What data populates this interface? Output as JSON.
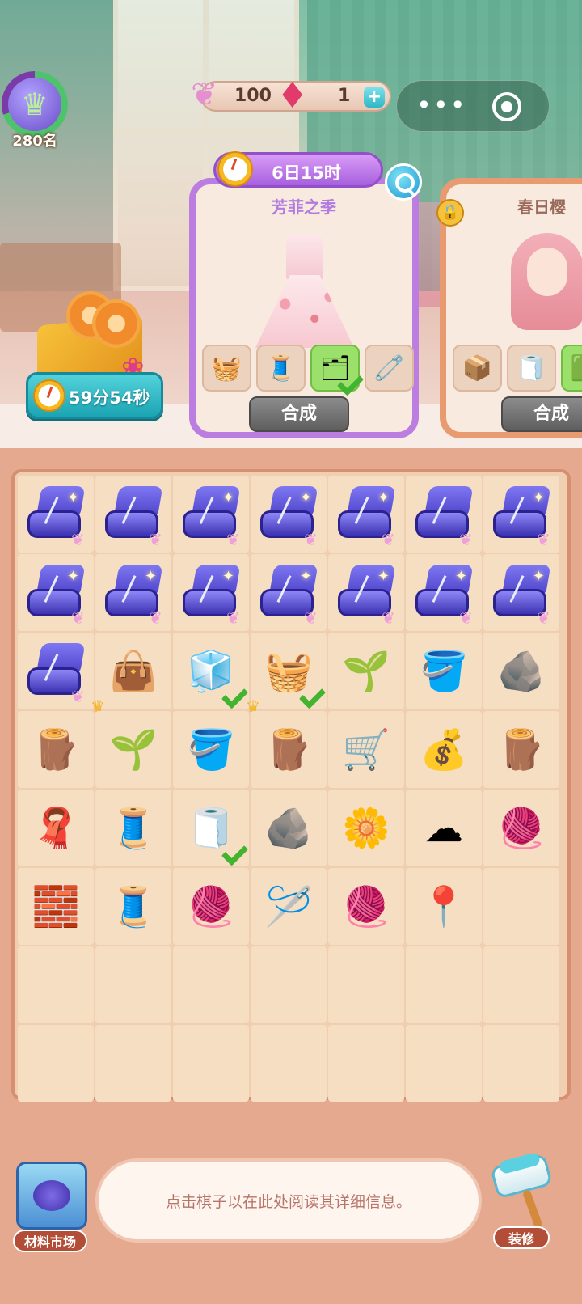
{
  "rank": {
    "label": "280名",
    "icon": "crown-icon"
  },
  "currency": {
    "feather_value": "100",
    "gem_value": "1",
    "plus_label": "+"
  },
  "capsule": {
    "more_label": "•••"
  },
  "event": {
    "timer": "59分54秒"
  },
  "cards": [
    {
      "timer": "6日15时",
      "title": "芳菲之季",
      "materials": [
        {
          "icon": "cotton-roll-basket-icon",
          "glyph": "🧺",
          "done": false
        },
        {
          "icon": "fabric-box-icon",
          "glyph": "🧵",
          "done": false
        },
        {
          "icon": "fabric-box-blue-icon",
          "glyph": "🗂",
          "done": true
        },
        {
          "icon": "pink-sewing-machine-icon",
          "glyph": "🧷",
          "done": false
        }
      ],
      "button": "合成"
    },
    {
      "title": "春日樱",
      "locked": true,
      "materials": [
        {
          "icon": "fabric-stack-box-icon",
          "glyph": "📦",
          "done": false
        },
        {
          "icon": "cotton-roll-icon",
          "glyph": "🧻",
          "done": false
        },
        {
          "icon": "green-item-icon",
          "glyph": "🟩",
          "done": true
        }
      ],
      "button": "合成"
    }
  ],
  "board": {
    "cells": [
      {
        "kind": "sewbox",
        "sparkle": true
      },
      {
        "kind": "sewbox",
        "sparkle": false
      },
      {
        "kind": "sewbox",
        "sparkle": true
      },
      {
        "kind": "sewbox",
        "sparkle": true
      },
      {
        "kind": "sewbox",
        "sparkle": true
      },
      {
        "kind": "sewbox",
        "sparkle": false
      },
      {
        "kind": "sewbox",
        "sparkle": true
      },
      {
        "kind": "sewbox",
        "sparkle": true
      },
      {
        "kind": "sewbox",
        "sparkle": true
      },
      {
        "kind": "sewbox",
        "sparkle": true
      },
      {
        "kind": "sewbox",
        "sparkle": true
      },
      {
        "kind": "sewbox",
        "sparkle": true
      },
      {
        "kind": "sewbox",
        "sparkle": true
      },
      {
        "kind": "sewbox",
        "sparkle": true
      },
      {
        "kind": "sewbox",
        "sparkle": false
      },
      {
        "kind": "item",
        "icon": "leather-bag-icon",
        "glyph": "👜",
        "crown": true
      },
      {
        "kind": "item",
        "icon": "fabric-crate-icon",
        "glyph": "🧊",
        "check": true
      },
      {
        "kind": "item",
        "icon": "towel-crate-icon",
        "glyph": "🧺",
        "crown": true,
        "check": true
      },
      {
        "kind": "item",
        "icon": "sprout-box-icon",
        "glyph": "🌱"
      },
      {
        "kind": "item",
        "icon": "stone-scoop-icon",
        "glyph": "🪣"
      },
      {
        "kind": "item",
        "icon": "rock-icon",
        "glyph": "🪨"
      },
      {
        "kind": "item",
        "icon": "wood-planks-icon",
        "glyph": "🪵"
      },
      {
        "kind": "item",
        "icon": "sprout-pot-icon",
        "glyph": "🌱"
      },
      {
        "kind": "item",
        "icon": "stone-bucket-icon",
        "glyph": "🪣"
      },
      {
        "kind": "item",
        "icon": "log-cart-red-icon",
        "glyph": "🪵"
      },
      {
        "kind": "item",
        "icon": "stone-cart-icon",
        "glyph": "🛒"
      },
      {
        "kind": "item",
        "icon": "seed-sack-icon",
        "glyph": "💰"
      },
      {
        "kind": "item",
        "icon": "log-cart-red-icon",
        "glyph": "🪵"
      },
      {
        "kind": "item",
        "icon": "teal-cloth-icon",
        "glyph": "🧣"
      },
      {
        "kind": "item",
        "icon": "sewing-machine-icon",
        "glyph": "🧵"
      },
      {
        "kind": "item",
        "icon": "cotton-roll-icon",
        "glyph": "🧻",
        "check": true
      },
      {
        "kind": "item",
        "icon": "rocks-icon",
        "glyph": "🪨"
      },
      {
        "kind": "item",
        "icon": "cotton-flower-icon",
        "glyph": "🌼"
      },
      {
        "kind": "item",
        "icon": "cotton-pile-icon",
        "glyph": "☁"
      },
      {
        "kind": "item",
        "icon": "thread-spool-icon",
        "glyph": "🧶"
      },
      {
        "kind": "item",
        "icon": "stone-slab-icon",
        "glyph": "🧱"
      },
      {
        "kind": "item",
        "icon": "thread-spools-icon",
        "glyph": "🧵"
      },
      {
        "kind": "item",
        "icon": "yarn-basket-icon",
        "glyph": "🧶"
      },
      {
        "kind": "item",
        "icon": "loom-icon",
        "glyph": "🪡"
      },
      {
        "kind": "item",
        "icon": "yarn-ball-icon",
        "glyph": "🧶"
      },
      {
        "kind": "item",
        "icon": "pincushion-icon",
        "glyph": "📍"
      },
      {
        "kind": "empty"
      },
      {
        "kind": "empty"
      },
      {
        "kind": "empty"
      },
      {
        "kind": "empty"
      },
      {
        "kind": "empty"
      },
      {
        "kind": "empty"
      },
      {
        "kind": "empty"
      },
      {
        "kind": "empty"
      },
      {
        "kind": "empty"
      },
      {
        "kind": "empty"
      },
      {
        "kind": "empty"
      },
      {
        "kind": "empty"
      },
      {
        "kind": "empty"
      },
      {
        "kind": "empty"
      },
      {
        "kind": "empty"
      }
    ]
  },
  "bottom": {
    "market_label": "材料市场",
    "info_text": "点击棋子以在此处阅读其详细信息。",
    "decor_label": "装修"
  }
}
